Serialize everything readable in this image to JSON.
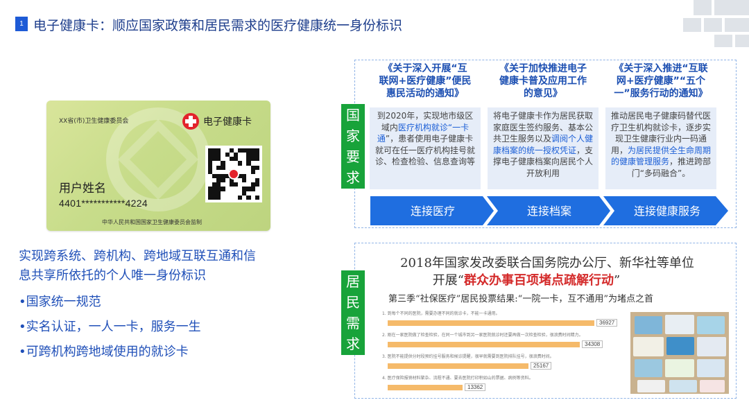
{
  "title": {
    "badge": "1",
    "text": "电子健康卡：顺应国家政策和居民需求的医疗健康统一身份标识"
  },
  "card": {
    "org": "XX省(市)卫生健康委员会",
    "brand": "电子健康卡",
    "holder_label": "用户姓名",
    "number": "4401***********4224",
    "footer": "中华人民共和国国家卫生健康委员会监制",
    "colors": {
      "logo": "#e3232c",
      "background": "#c7dc8a"
    }
  },
  "summary": {
    "lines": [
      "实现跨系统、跨机构、跨地域互联互通和信",
      "息共享所依托的个人唯一身份标识",
      "•国家统一规范",
      "•实名认证，一人一卡，服务一生",
      "•可跨机构跨地域使用的就诊卡"
    ]
  },
  "national": {
    "side_label": [
      "国",
      "家",
      "要",
      "求"
    ],
    "columns": [
      {
        "title": [
          "《关于深入开展“互",
          "联网+医疗健康”便民",
          "惠民活动的通知》"
        ],
        "body": [
          {
            "t": "到2020年，实现地市级区"
          },
          {
            "t": "域内"
          },
          {
            "t": "医疗机构就诊“一卡",
            "hl": true
          },
          {
            "t": "通",
            "hl": true
          },
          {
            "t": "”，患者使用电子健康"
          },
          {
            "t": "卡就可在任一医疗机构挂号就诊、检查检验、信息查询等"
          }
        ]
      },
      {
        "title": [
          "《关于加快推进电子",
          "健康卡普及应用工作",
          "的意见》"
        ],
        "body": [
          {
            "t": "将电子健康卡作为居民获取家庭医生签约服务、基本公共卫生服务以及"
          },
          {
            "t": "调阅个人健康档案的统一授权凭证",
            "hl": true
          },
          {
            "t": "，支撑电子健康档案向居民个人开放利用"
          }
        ]
      },
      {
        "title": [
          "《关于深入推进“互联",
          "网+医疗健康”“五个",
          "一”服务行动的通知》"
        ],
        "body": [
          {
            "t": "推动居民电子健康码替代医疗卫生机构就诊卡，逐步实现卫生健康行业内一码通用，"
          },
          {
            "t": "为居民提供全生命周期的健康管理服务",
            "hl": true
          },
          {
            "t": "，推进跨部门“多码融合”。"
          }
        ]
      }
    ],
    "arrows": [
      "连接医疗",
      "连接档案",
      "连接健康服务"
    ],
    "colors": {
      "arrow": "#1f6ee0",
      "side": "#18a33a",
      "highlight": "#1c5fd6"
    }
  },
  "resident": {
    "side_label": [
      "居",
      "民",
      "需",
      "求"
    ],
    "headline1": "2018年国家发改委联合国务院办公厅、新华社等单位",
    "headline2_prefix": "开展“",
    "headline2_red": "群众办事百项堵点疏解行动",
    "headline2_suffix": "”",
    "subtitle": "第三季“社保医疗”居民投票结果:“一院一卡，互不通用”为堵点之首",
    "vote_max": 36927,
    "votes": [
      {
        "label": "1. 到每个不同的医院，需要办理不同的就诊卡，不能一卡通用。",
        "value": 36927,
        "display": "36927"
      },
      {
        "label": "2. 刚在一家医院做了检查检验，在同一个城市到另一家医院就诊时还要再做一次检查检验，很浪费时间精力。",
        "value": 34308,
        "display": "34308"
      },
      {
        "label": "3. 医院不能提供分时段预约挂号服务和候诊提醒，很早就需要到医院排队挂号，很浪费时间。",
        "value": 25167,
        "display": "25167"
      },
      {
        "label": "4. 医疗保险报销材料繁杂、流程不通、要去医院打印积如山的票据、病例等资料。",
        "value": 13362,
        "display": "13362"
      }
    ],
    "colors": {
      "bar": "#f5ba6a",
      "emphasis": "#d42a2a"
    }
  }
}
